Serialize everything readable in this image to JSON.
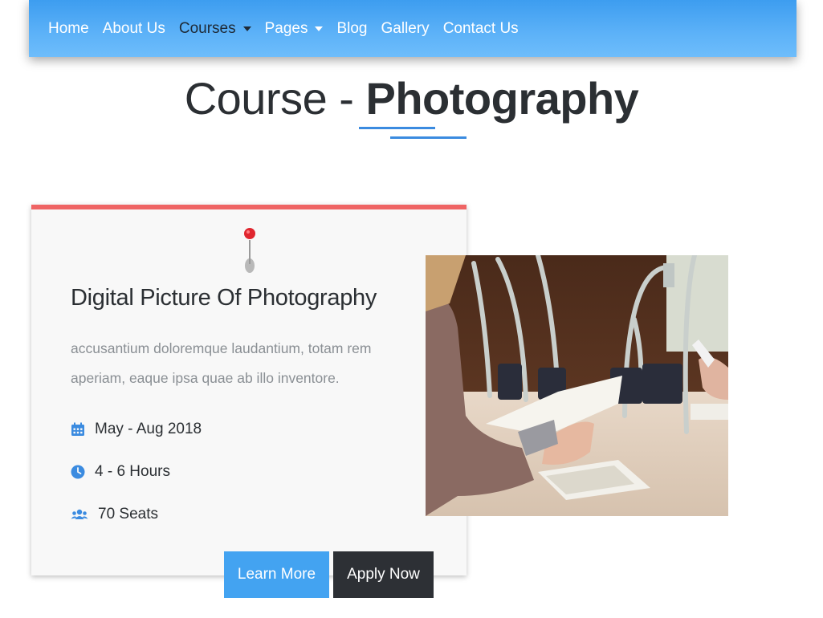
{
  "nav": {
    "items": [
      {
        "label": "Home",
        "dropdown": false,
        "active": false
      },
      {
        "label": "About Us",
        "dropdown": false,
        "active": false
      },
      {
        "label": "Courses",
        "dropdown": true,
        "active": true
      },
      {
        "label": "Pages",
        "dropdown": true,
        "active": false
      },
      {
        "label": "Blog",
        "dropdown": false,
        "active": false
      },
      {
        "label": "Gallery",
        "dropdown": false,
        "active": false
      },
      {
        "label": "Contact Us",
        "dropdown": false,
        "active": false
      }
    ]
  },
  "page": {
    "title_prefix": "Course - ",
    "title_emphasis": "Photography"
  },
  "course": {
    "title": "Digital Picture Of Photography",
    "description": "accusantium doloremque laudantium, totam rem aperiam, eaque ipsa quae ab illo inventore.",
    "dates": "May - Aug 2018",
    "duration": "4 - 6 Hours",
    "seats": "70 Seats",
    "learn_more_label": "Learn More",
    "apply_label": "Apply Now"
  },
  "icons": {
    "pin": "map-pin-icon",
    "dates": "calendar-icon",
    "duration": "clock-icon",
    "seats": "users-icon"
  },
  "colors": {
    "nav_gradient": "#4aa6f4",
    "accent_blue": "#43a3f1",
    "card_top_border": "#ef6464",
    "apply_button": "#2d3035"
  }
}
